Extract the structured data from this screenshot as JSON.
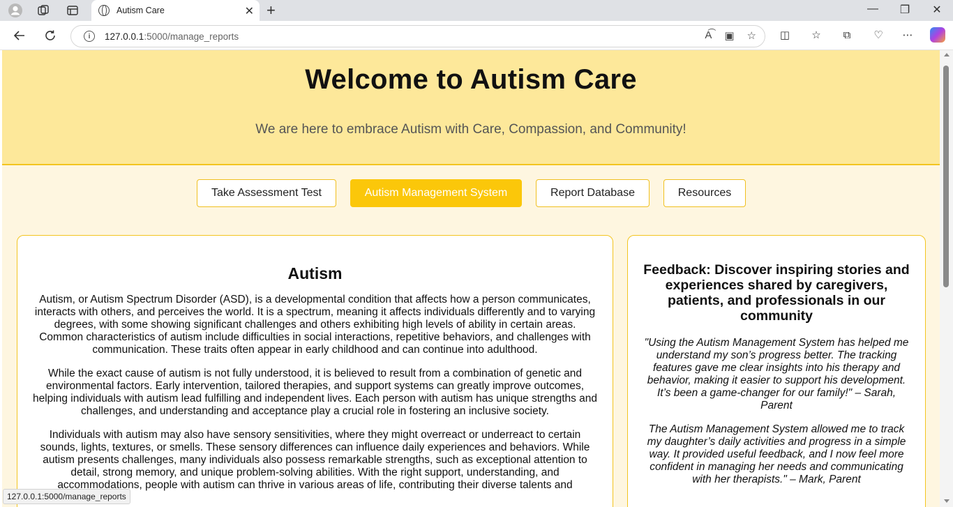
{
  "browser": {
    "tab_title": "Autism Care",
    "url_host": "127.0.0.1",
    "url_path": ":5000/manage_reports",
    "status_url": "127.0.0.1:5000/manage_reports"
  },
  "hero": {
    "title": "Welcome to Autism Care",
    "subtitle": "We are here to embrace Autism with Care, Compassion, and Community!"
  },
  "nav": {
    "buttons": [
      {
        "label": "Take Assessment Test",
        "active": false
      },
      {
        "label": "Autism Management System",
        "active": true
      },
      {
        "label": "Report Database",
        "active": false
      },
      {
        "label": "Resources",
        "active": false
      }
    ]
  },
  "main": {
    "heading": "Autism",
    "paragraphs": [
      "Autism, or Autism Spectrum Disorder (ASD), is a developmental condition that affects how a person communicates, interacts with others, and perceives the world. It is a spectrum, meaning it affects individuals differently and to varying degrees, with some showing significant challenges and others exhibiting high levels of ability in certain areas. Common characteristics of autism include difficulties in social interactions, repetitive behaviors, and challenges with communication. These traits often appear in early childhood and can continue into adulthood.",
      "While the exact cause of autism is not fully understood, it is believed to result from a combination of genetic and environmental factors. Early intervention, tailored therapies, and support systems can greatly improve outcomes, helping individuals with autism lead fulfilling and independent lives. Each person with autism has unique strengths and challenges, and understanding and acceptance play a crucial role in fostering an inclusive society.",
      "Individuals with autism may also have sensory sensitivities, where they might overreact or underreact to certain sounds, lights, textures, or smells. These sensory differences can influence daily experiences and behaviors. While autism presents challenges, many individuals also possess remarkable strengths, such as exceptional attention to detail, strong memory, and unique problem-solving abilities. With the right support, understanding, and accommodations, people with autism can thrive in various areas of life, contributing their diverse talents and"
    ]
  },
  "feedback": {
    "heading": "Feedback: Discover inspiring stories and experiences shared by caregivers, patients, and professionals in our community",
    "quotes": [
      "\"Using the Autism Management System has helped me understand my son’s progress better. The tracking features gave me clear insights into his therapy and behavior, making it easier to support his development. It’s been a game-changer for our family!\" – Sarah, Parent",
      "The Autism Management System allowed me to track my daughter’s daily activities and progress in a simple way. It provided useful feedback, and I now feel more confident in managing her needs and communicating with her therapists.\" – Mark, Parent"
    ]
  },
  "colors": {
    "hero_bg": "#fde89a",
    "page_bg": "#fef6e0",
    "accent": "#fbc70a"
  }
}
